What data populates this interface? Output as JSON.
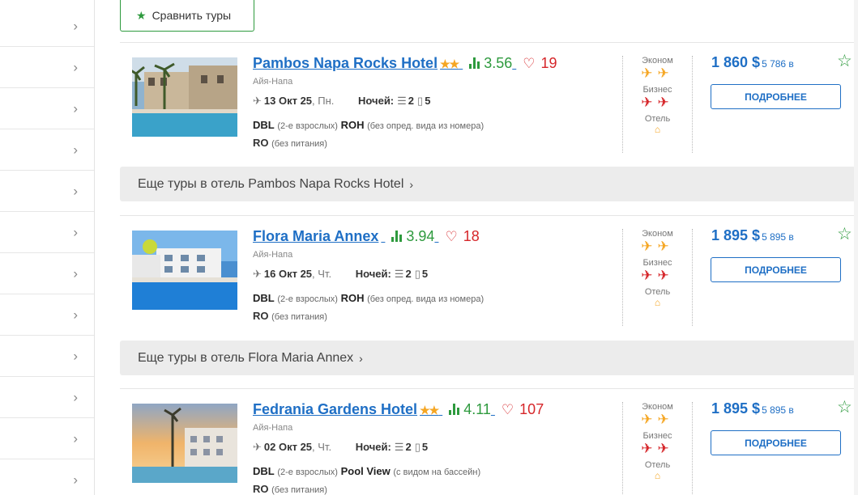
{
  "sidebar": {
    "rows": [
      {
        "chevron": "›"
      },
      {
        "chevron": "›"
      },
      {
        "chevron": "›"
      },
      {
        "chevron": "›"
      },
      {
        "chevron": "›"
      },
      {
        "chevron": "›"
      },
      {
        "chevron": "›"
      },
      {
        "chevron": "›"
      },
      {
        "chevron": "›"
      },
      {
        "chevron": "›"
      },
      {
        "chevron": "›"
      },
      {
        "chevron": "›"
      }
    ]
  },
  "compare": {
    "icon": "★",
    "label": "Сравнить туры"
  },
  "labels": {
    "nights": "Ночей:",
    "econom": "Эконом",
    "business": "Бизнес",
    "hotel": "Отель",
    "details": "ПОДРОБНЕЕ",
    "no_view": "(без опред. вида из номера)",
    "adults": "(2-е взрослых)",
    "no_meal": "(без питания)",
    "pool_view_note": "(с видом на бассейн)",
    "plane_glyph": "✈",
    "plane_pair": "✈✈",
    "house_glyph": "⌂",
    "heart": "♡",
    "fav_star": "☆",
    "gt": "›"
  },
  "colors": {
    "link_blue": "#1f6fc5",
    "green": "#2e9a3e",
    "red": "#d6262a",
    "orange": "#f5a623"
  },
  "hotels": [
    {
      "name": "Pambos Napa Rocks Hotel",
      "stars": "★★",
      "rating": "3.56",
      "reviews": "19",
      "city": "Айя-Напа",
      "date": "13 Окт 25",
      "dow": ", Пн.",
      "adults": "2",
      "nights_count": "5",
      "room_type": "DBL",
      "room_view": "ROH",
      "room_view_note": "(без опред. вида из номера)",
      "meal": "RO",
      "price_usd": "1 860 $",
      "price_byn": "5 786 ʙ",
      "more_tours": "Еще туры в отель Pambos Napa Rocks Hotel"
    },
    {
      "name": "Flora Maria Annex",
      "stars": "",
      "rating": "3.94",
      "reviews": "18",
      "city": "Айя-Напа",
      "date": "16 Окт 25",
      "dow": ", Чт.",
      "adults": "2",
      "nights_count": "5",
      "room_type": "DBL",
      "room_view": "ROH",
      "room_view_note": "(без опред. вида из номера)",
      "meal": "RO",
      "price_usd": "1 895 $",
      "price_byn": "5 895 ʙ",
      "more_tours": "Еще туры в отель Flora Maria Annex"
    },
    {
      "name": "Fedrania Gardens Hotel",
      "stars": "★★",
      "rating": "4.11",
      "reviews": "107",
      "city": "Айя-Напа",
      "date": "02 Окт 25",
      "dow": ", Чт.",
      "adults": "2",
      "nights_count": "5",
      "room_type": "DBL",
      "room_view": "Pool View",
      "room_view_note": "(с видом на бассейн)",
      "meal": "RO",
      "price_usd": "1 895 $",
      "price_byn": "5 895 ʙ",
      "more_tours": ""
    }
  ]
}
